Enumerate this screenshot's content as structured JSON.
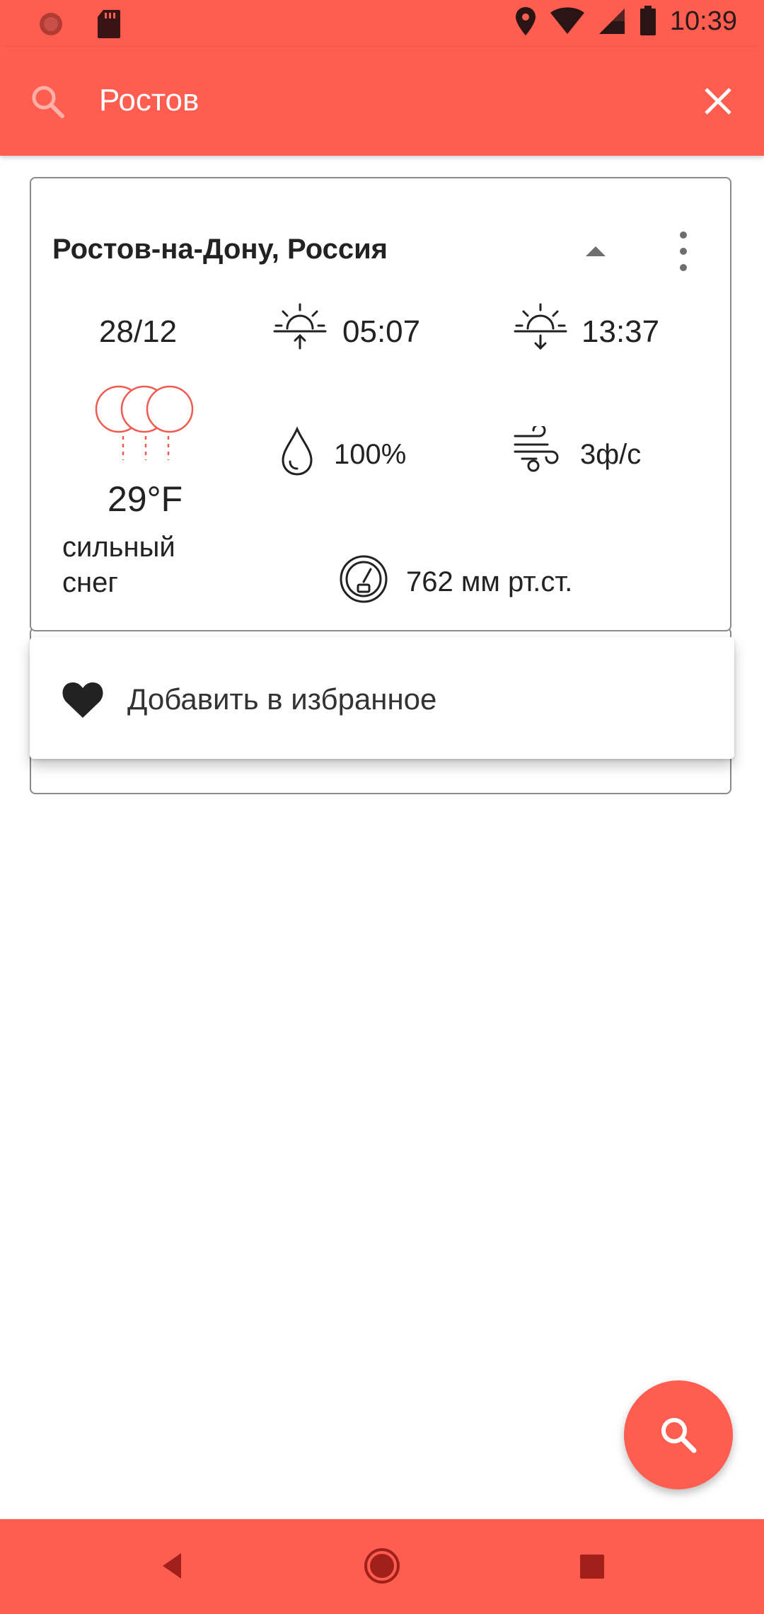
{
  "status": {
    "time": "10:39",
    "left_icons": [
      "app-icon",
      "sd-card-icon"
    ],
    "right_icons": [
      "location-icon",
      "wifi-icon",
      "signal-icon",
      "battery-icon"
    ]
  },
  "search": {
    "query": "Ростов",
    "placeholder": "",
    "icon": "search-icon",
    "clear_icon": "close-icon"
  },
  "result": {
    "city": "Ростов-на-Дону, Россия",
    "date": "28/12",
    "sunrise": "05:07",
    "sunset": "13:37",
    "temperature": "29°F",
    "condition": "сильный снег",
    "humidity": "100%",
    "wind": "3ф/с",
    "pressure": "762 мм рт.ст."
  },
  "menu": {
    "items": [
      {
        "label": "Добавить в избранное",
        "icon": "heart-icon"
      }
    ]
  },
  "colors": {
    "accent": "#fe5d50",
    "weather_icon": "#f05a4f",
    "text": "#222222"
  },
  "navbar": {
    "icons": [
      "back-icon",
      "home-icon",
      "recents-icon"
    ]
  }
}
